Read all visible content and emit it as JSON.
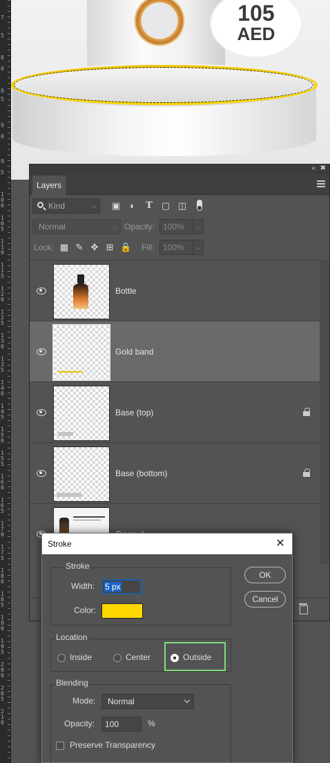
{
  "ruler": {
    "numbers": [
      "7",
      "5",
      "8",
      "0",
      "8",
      "5",
      "9",
      "0",
      "9",
      "5",
      "1 0 0",
      "1 0 5",
      "1 1 0",
      "1 1 5",
      "1 2 0",
      "1 2 5",
      "1 3 0",
      "1 3 5",
      "1 4 0",
      "1 4 5",
      "1 5 0",
      "1 5 5",
      "1 6 0",
      "1 6 5",
      "1 7 0",
      "1 7 5",
      "1 8 0",
      "1 8 5",
      "1 9 0",
      "1 9 5",
      "2 0 0",
      "2 0 5",
      "2 1 0"
    ]
  },
  "canvas": {
    "price_amount": "105",
    "price_currency": "AED",
    "ring_color": "#f8d400"
  },
  "layers_panel": {
    "tab_label": "Layers",
    "filter": {
      "kind_label": "Kind",
      "icons": [
        "image-filter-icon",
        "adjustment-filter-icon",
        "type-filter-icon",
        "shape-filter-icon",
        "smart-object-filter-icon",
        "filter-toggle-icon"
      ]
    },
    "blend_mode": "Normal",
    "opacity_label": "Opacity:",
    "opacity_value": "100%",
    "lock_label": "Lock:",
    "fill_label": "Fill:",
    "fill_value": "100%",
    "layers": [
      {
        "name": "Bottle",
        "visible": true,
        "locked": false,
        "selected": false
      },
      {
        "name": "Gold band",
        "visible": true,
        "locked": false,
        "selected": true
      },
      {
        "name": "Base (top)",
        "visible": true,
        "locked": true,
        "selected": false
      },
      {
        "name": "Base (bottom)",
        "visible": true,
        "locked": true,
        "selected": false
      },
      {
        "name": "Original",
        "visible": true,
        "locked": false,
        "selected": false
      }
    ]
  },
  "stroke_dialog": {
    "title": "Stroke",
    "stroke_group": "Stroke",
    "width_label": "Width:",
    "width_value": "5 px",
    "color_label": "Color:",
    "color_value": "#ffd800",
    "location_group": "Location",
    "location_options": [
      "Inside",
      "Center",
      "Outside"
    ],
    "location_selected": "Outside",
    "blending_group": "Blending",
    "mode_label": "Mode:",
    "mode_value": "Normal",
    "opacity_label": "Opacity:",
    "opacity_value": "100",
    "opacity_unit": "%",
    "preserve_transparency_label": "Preserve Transparency",
    "preserve_transparency_checked": false,
    "ok_label": "OK",
    "cancel_label": "Cancel"
  }
}
